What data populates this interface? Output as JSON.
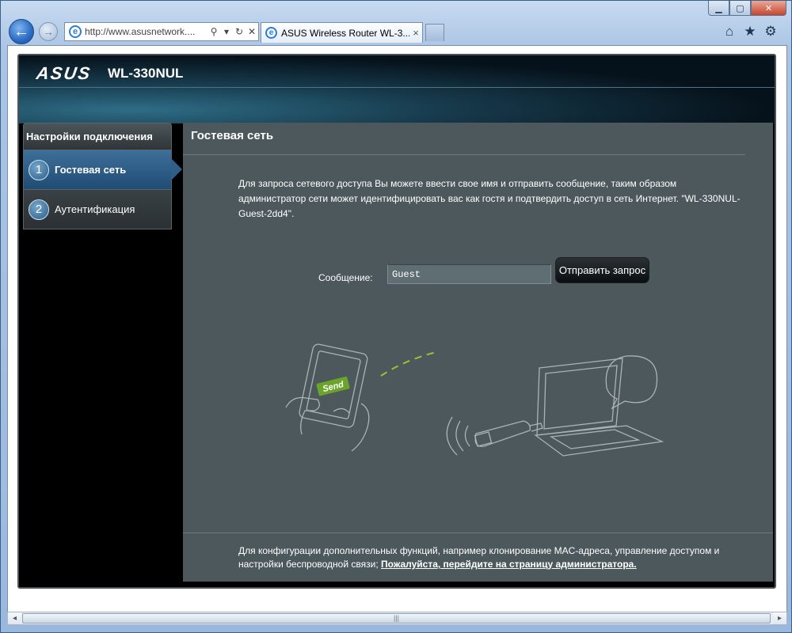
{
  "browser": {
    "address_url": "http://www.asusnetwork....",
    "tab_title": "ASUS Wireless Router WL-3...",
    "tab_close": "×",
    "right_icons": [
      "home-icon",
      "star-icon",
      "gear-icon"
    ]
  },
  "header": {
    "logo": "ASUS",
    "model": "WL-330NUL"
  },
  "sidebar": {
    "title": "Настройки подключения",
    "items": [
      {
        "number": "1",
        "label": "Гостевая сеть",
        "active": true
      },
      {
        "number": "2",
        "label": "Аутентификация",
        "active": false
      }
    ]
  },
  "main": {
    "title": "Гостевая сеть",
    "description": "Для запроса сетевого доступа Вы можете ввести свое имя и отправить сообщение, таким образом администратор сети может идентифицировать вас как гостя и подтвердить доступ в сеть Интернет. \"WL-330NUL-Guest-2dd4\".",
    "message_label": "Сообщение:",
    "message_value": "Guest",
    "send_button": "Отправить запрос",
    "illustration_send_label": "Send",
    "footer_text": "Для конфигурации дополнительных функций, например клонирование MAC-адреса, управление доступом и настройки беспроводной связи;",
    "footer_link": "Пожалуйста, перейдите на страницу администратора."
  },
  "colors": {
    "panel": "#4d585d",
    "active_menu": "#2f5f88",
    "send_badge": "#6aa52a"
  }
}
